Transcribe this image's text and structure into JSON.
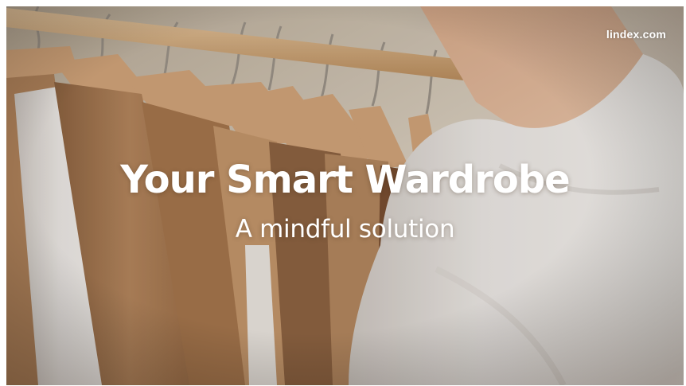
{
  "brand": {
    "name": "lindex.com"
  },
  "hero": {
    "headline": "Your Smart Wardrobe",
    "subheadline": "A mindful solution"
  }
}
